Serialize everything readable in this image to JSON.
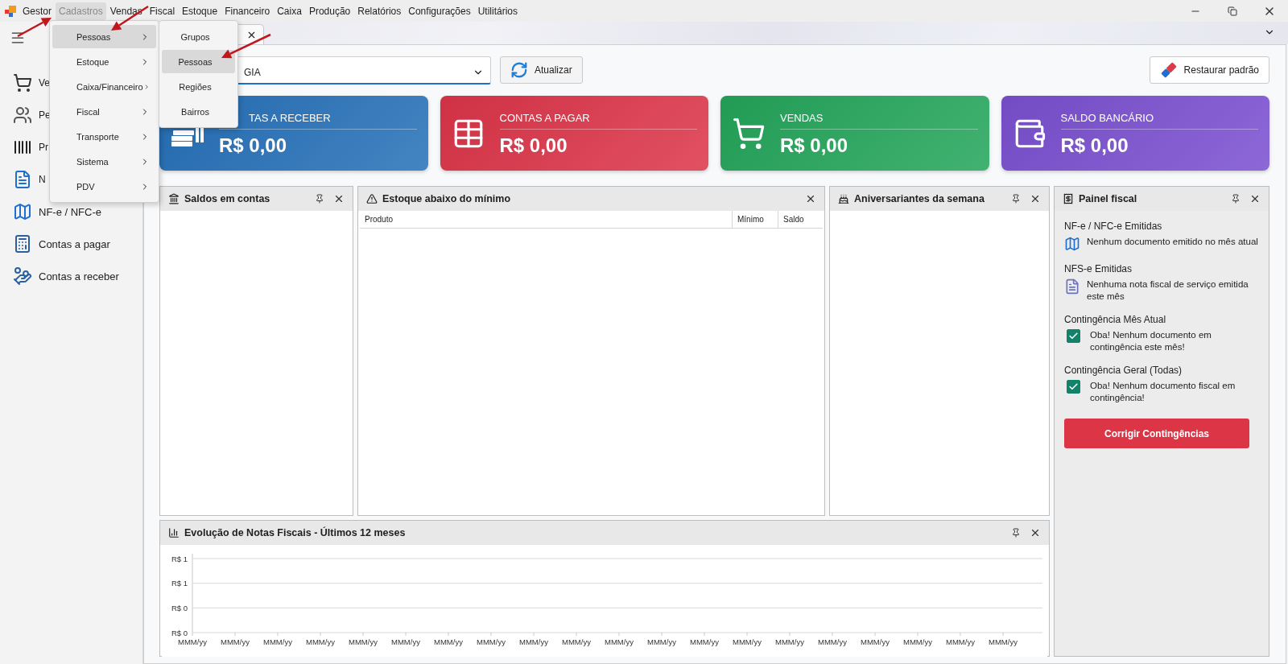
{
  "menu_bar": {
    "items": [
      {
        "label": "Gestor",
        "selected": false
      },
      {
        "label": "Cadastros",
        "selected": true
      },
      {
        "label": "Vendas",
        "selected": false
      },
      {
        "label": "Fiscal",
        "selected": false
      },
      {
        "label": "Estoque",
        "selected": false
      },
      {
        "label": "Financeiro",
        "selected": false
      },
      {
        "label": "Caixa",
        "selected": false
      },
      {
        "label": "Produção",
        "selected": false
      },
      {
        "label": "Relatórios",
        "selected": false
      },
      {
        "label": "Configurações",
        "selected": false
      },
      {
        "label": "Utilitários",
        "selected": false
      }
    ]
  },
  "cadastros_menu": {
    "items": [
      {
        "label": "Pessoas",
        "selected": true
      },
      {
        "label": "Estoque",
        "selected": false
      },
      {
        "label": "Caixa/Financeiro",
        "selected": false
      },
      {
        "label": "Fiscal",
        "selected": false
      },
      {
        "label": "Transporte",
        "selected": false
      },
      {
        "label": "Sistema",
        "selected": false
      },
      {
        "label": "PDV",
        "selected": false
      }
    ]
  },
  "submenu": {
    "items": [
      {
        "label": "Grupos",
        "selected": false
      },
      {
        "label": "Pessoas",
        "selected": true
      },
      {
        "label": "Regiões",
        "selected": false
      },
      {
        "label": "Bairros",
        "selected": false
      }
    ]
  },
  "sidebar": {
    "items": [
      {
        "label": "Ve",
        "kind": "cart"
      },
      {
        "label": "Pe",
        "kind": "people"
      },
      {
        "label": "Pr",
        "kind": "barcode"
      },
      {
        "label": "N",
        "kind": "nfse"
      },
      {
        "label": "NF-e / NFC-e",
        "kind": "nfe"
      },
      {
        "label": "Contas a pagar",
        "kind": "payable"
      },
      {
        "label": "Contas a receber",
        "kind": "receivable"
      }
    ]
  },
  "filter": {
    "value": "GIA"
  },
  "refresh_button": "Atualizar",
  "restore_button": "Restaurar padrão",
  "cards": [
    {
      "title": "TAS A RECEBER",
      "value": "R$ 0,00",
      "kind": "receivable",
      "color": "#2570b8"
    },
    {
      "title": "CONTAS A PAGAR",
      "value": "R$ 0,00",
      "kind": "payable",
      "color": "#dc3448"
    },
    {
      "title": "VENDAS",
      "value": "R$ 0,00",
      "kind": "sales",
      "color": "#23a55a"
    },
    {
      "title": "SALDO BANCÁRIO",
      "value": "R$ 0,00",
      "kind": "bank",
      "color": "#7a4fd0"
    }
  ],
  "saldos_panel": {
    "title": "Saldos em contas"
  },
  "estoque_panel": {
    "title": "Estoque abaixo do mínimo",
    "columns": [
      "Produto",
      "Mínimo",
      "Saldo"
    ]
  },
  "aniversariantes_panel": {
    "title": "Aniversariantes da semana"
  },
  "fiscal_panel": {
    "title": "Painel fiscal",
    "sections": [
      {
        "heading": "NF-e / NFC-e Emitidas",
        "message": "Nenhum documento emitido no mês atual",
        "kind": "nfe"
      },
      {
        "heading": "NFS-e Emitidas",
        "message": "Nenhuma nota fiscal de serviço emitida este mês",
        "kind": "nfse"
      },
      {
        "heading": "Contingência Mês Atual",
        "message": "Oba! Nenhum documento em contingência este mês!",
        "kind": "check",
        "checked": true
      },
      {
        "heading": "Contingência Geral (Todas)",
        "message": "Oba! Nenhum documento fiscal em contingência!",
        "kind": "check",
        "checked": true
      }
    ],
    "button": "Corrigir Contingências"
  },
  "chart_panel": {
    "title": "Evolução de Notas Fiscais - Últimos 12 meses",
    "x_labels": [
      "MMM/yy",
      "MMM/yy",
      "MMM/yy",
      "MMM/yy",
      "MMM/yy",
      "MMM/yy",
      "MMM/yy",
      "MMM/yy",
      "MMM/yy",
      "MMM/yy",
      "MMM/yy",
      "MMM/yy",
      "MMM/yy",
      "MMM/yy",
      "MMM/yy",
      "MMM/yy",
      "MMM/yy",
      "MMM/yy",
      "MMM/yy",
      "MMM/yy"
    ],
    "y_labels": [
      "R$ 1",
      "R$ 1",
      "R$ 0",
      "R$ 0"
    ]
  }
}
